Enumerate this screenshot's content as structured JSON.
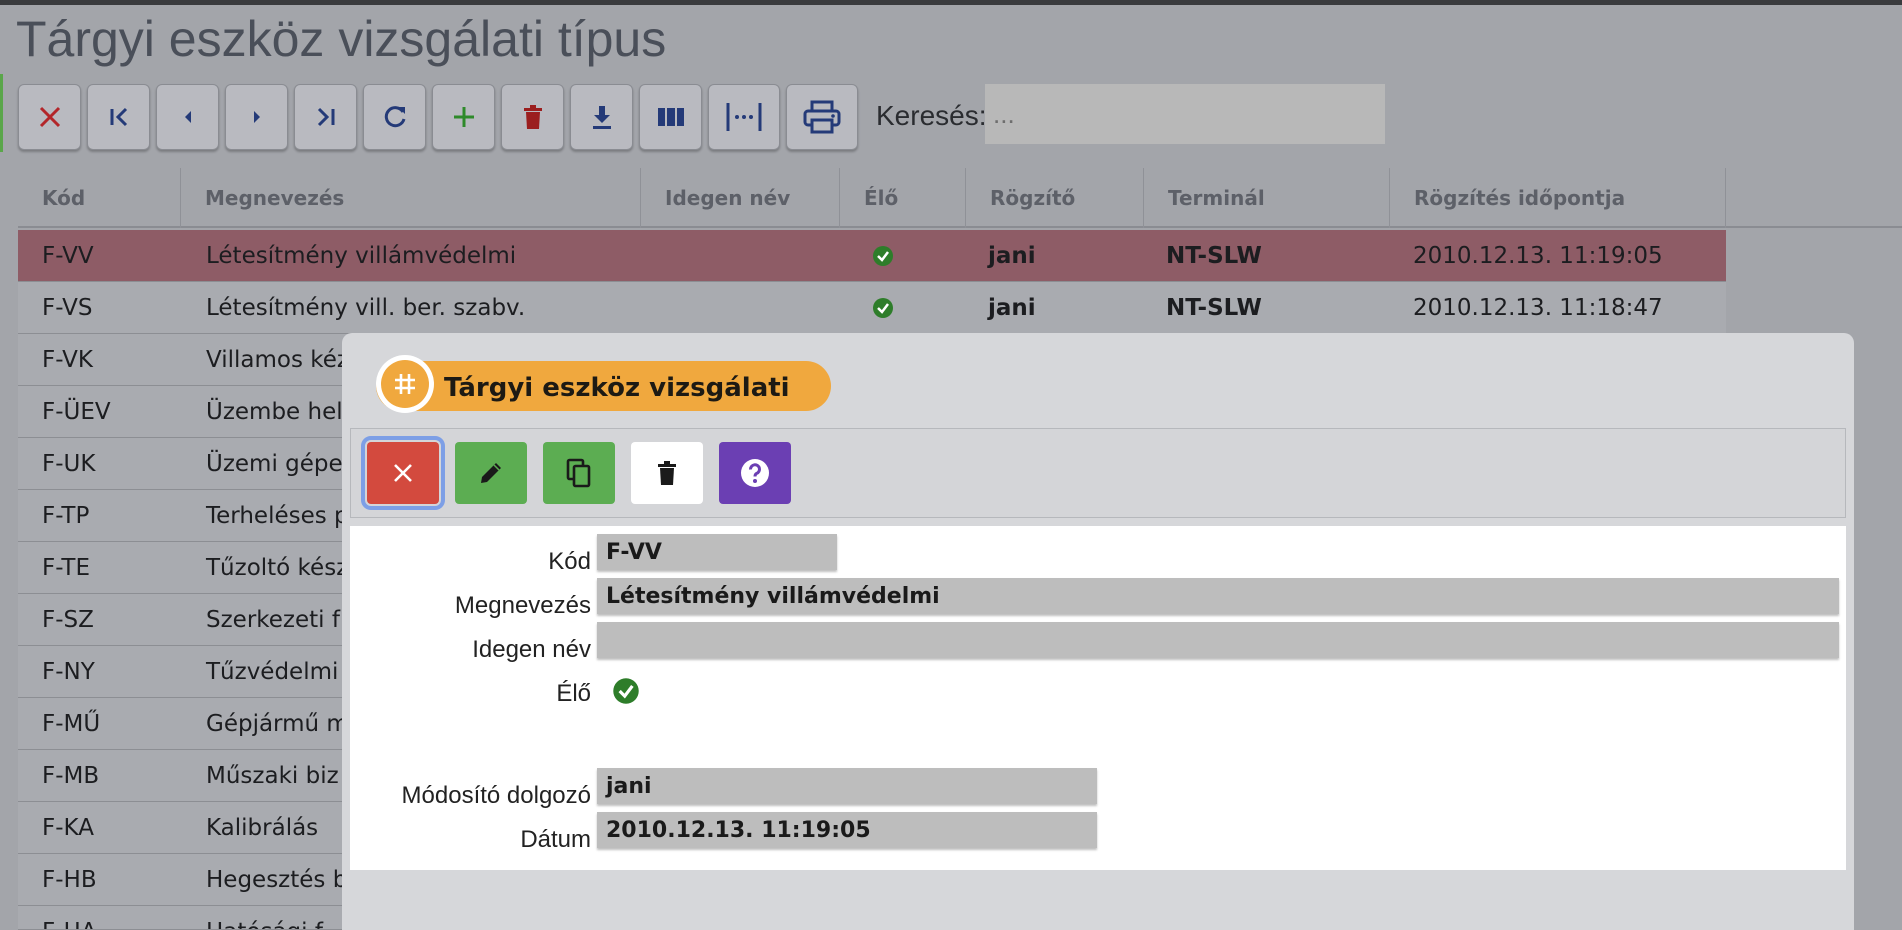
{
  "page": {
    "title": "Tárgyi eszköz vizsgálati típus"
  },
  "toolbar": {
    "buttons": [
      {
        "icon": "close-icon",
        "color": "#b3262a"
      },
      {
        "icon": "first-page-icon",
        "color": "#243a78"
      },
      {
        "icon": "previous-icon",
        "color": "#243a78"
      },
      {
        "icon": "next-icon",
        "color": "#243a78"
      },
      {
        "icon": "last-page-icon",
        "color": "#243a78"
      },
      {
        "icon": "refresh-icon",
        "color": "#243a78"
      },
      {
        "icon": "add-icon",
        "color": "#2e8a2a"
      },
      {
        "icon": "trash-icon",
        "color": "#9b1e1e"
      },
      {
        "icon": "download-icon",
        "color": "#243a78"
      },
      {
        "icon": "columns-icon",
        "color": "#243a78"
      },
      {
        "icon": "column-width-icon",
        "color": "#243a78"
      },
      {
        "icon": "print-icon",
        "color": "#243a78"
      }
    ]
  },
  "search": {
    "label": "Keresés:",
    "placeholder": "...",
    "value": ""
  },
  "table": {
    "headers": [
      "Kód",
      "Megnevezés",
      "Idegen név",
      "Élő",
      "Rögzítő",
      "Terminál",
      "Rögzítés időpontja"
    ],
    "rows": [
      {
        "kod": "F-VV",
        "megnevezes": "Létesítmény villámvédelmi",
        "elo": true,
        "rogzito": "jani",
        "terminal": "NT-SLW",
        "idopont": "2010.12.13. 11:19:05",
        "selected": true
      },
      {
        "kod": "F-VS",
        "megnevezes": "Létesítmény vill. ber. szabv.",
        "elo": true,
        "rogzito": "jani",
        "terminal": "NT-SLW",
        "idopont": "2010.12.13. 11:18:47"
      },
      {
        "kod": "F-VK",
        "megnevezes": "Villamos kéz"
      },
      {
        "kod": "F-ÜEV",
        "megnevezes": "Üzembe hel"
      },
      {
        "kod": "F-UK",
        "megnevezes": "Üzemi gépe"
      },
      {
        "kod": "F-TP",
        "megnevezes": "Terheléses p"
      },
      {
        "kod": "F-TE",
        "megnevezes": "Tűzoltó kész"
      },
      {
        "kod": "F-SZ",
        "megnevezes": "Szerkezeti f"
      },
      {
        "kod": "F-NY",
        "megnevezes": "Tűzvédelmi"
      },
      {
        "kod": "F-MŰ",
        "megnevezes": "Gépjármű m"
      },
      {
        "kod": "F-MB",
        "megnevezes": "Műszaki biz"
      },
      {
        "kod": "F-KA",
        "megnevezes": "Kalibrálás"
      },
      {
        "kod": "F-HB",
        "megnevezes": "Hegesztés b"
      },
      {
        "kod": "F-HA",
        "megnevezes": "Hatósági f"
      }
    ]
  },
  "modal": {
    "badge_title": "Tárgyi eszköz vizsgálati",
    "badge_color": "#f0a83e",
    "fields": {
      "kod": {
        "label": "Kód",
        "value": "F-VV"
      },
      "megnevezes": {
        "label": "Megnevezés",
        "value": "Létesítmény villámvédelmi"
      },
      "idegen_nev": {
        "label": "Idegen név",
        "value": ""
      },
      "elo": {
        "label": "Élő",
        "value": true
      },
      "modosito": {
        "label": "Módosító dolgozó",
        "value": "jani"
      },
      "datum": {
        "label": "Dátum",
        "value": "2010.12.13. 11:19:05"
      }
    }
  }
}
